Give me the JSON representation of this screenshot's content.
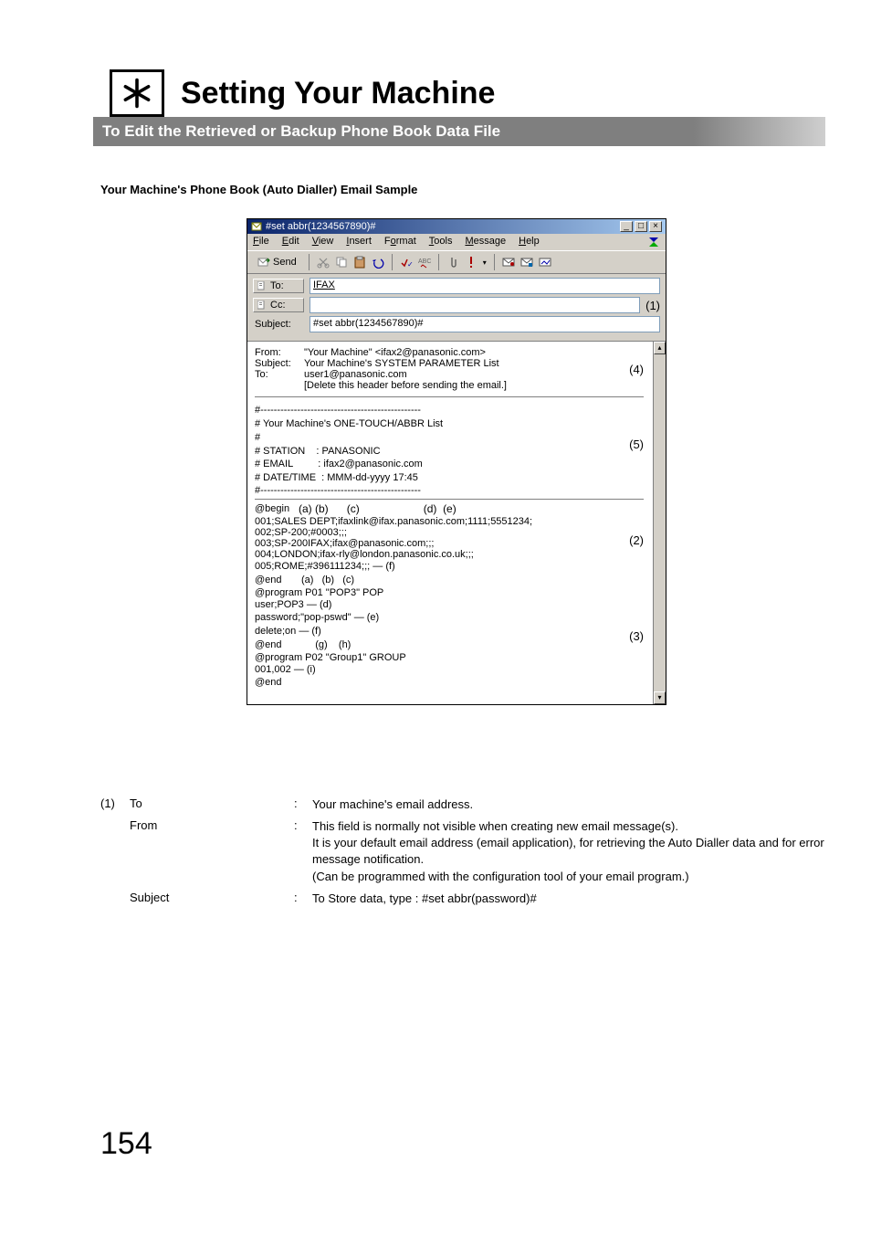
{
  "title": "Setting Your Machine",
  "subtitle": "To Edit the Retrieved or Backup Phone Book Data File",
  "section_heading": "Your Machine's Phone Book (Auto Dialler) Email Sample",
  "window": {
    "titlebar": "#set abbr(1234567890)#",
    "menus": {
      "file": "File",
      "edit": "Edit",
      "view": "View",
      "insert": "Insert",
      "format": "Format",
      "tools": "Tools",
      "message": "Message",
      "help": "Help"
    },
    "send": "Send",
    "to_label": "To:",
    "cc_label": "Cc:",
    "subject_label": "Subject:",
    "to_value": "IFAX",
    "cc_value": "",
    "subject_value": "#set abbr(1234567890)#"
  },
  "markers": {
    "m1": "(1)",
    "m2": "(2)",
    "m3": "(3)",
    "m4": "(4)",
    "m5": "(5)",
    "a": "(a)",
    "b": "(b)",
    "c": "(c)",
    "d": "(d)",
    "e": "(e)",
    "f": "(f)",
    "g": "(g)",
    "h": "(h)",
    "i": "(i)"
  },
  "body4": {
    "from_k": "From:",
    "from_v": "\"Your Machine\" <ifax2@panasonic.com>",
    "subj_k": "Subject:",
    "subj_v": "Your Machine's SYSTEM PARAMETER List",
    "to_k": "To:",
    "to_v": "user1@panasonic.com",
    "delete": "[Delete this header before sending the email.]"
  },
  "body5": {
    "l1": "#------------------------------------------------",
    "l2": "# Your Machine's ONE-TOUCH/ABBR List",
    "l3": "#",
    "l4": "# STATION    : PANASONIC",
    "l5": "# EMAIL         : ifax2@panasonic.com",
    "l6": "# DATE/TIME  : MMM-dd-yyyy 17:45",
    "l7": "#------------------------------------------------"
  },
  "body2": {
    "begin": "@begin",
    "r1": "001;SALES DEPT;ifaxlink@ifax.panasonic.com;1111;5551234;",
    "r2": "002;SP-200;#0003;;;",
    "r3": "003;SP-200IFAX;ifax@panasonic.com;;;",
    "r4": "004;LONDON;ifax-rly@london.panasonic.co.uk;;;",
    "r5": "005;ROME;#396111234;;;",
    "end1": "@end"
  },
  "body3": {
    "l1": "@program P01 \"POP3\" POP",
    "l2": "user;POP3",
    "l3": "password;\"pop-pswd\"",
    "l4": "delete;on",
    "l5": "@end",
    "l6": "@program P02 \"Group1\" GROUP",
    "l7": "001,002",
    "l8": "@end"
  },
  "defs": {
    "num1": "(1)",
    "to_k": "To",
    "to_v": "Your machine's email address.",
    "from_k": "From",
    "from_v": "This field is normally not visible when creating new email message(s).\nIt is your default email address (email application), for retrieving the Auto Dialler data and for error message notification.\n(Can be programmed with the configuration tool of your email program.)",
    "subj_k": "Subject",
    "subj_v": "To Store data, type :  #set abbr(password)#"
  },
  "page_number": "154"
}
